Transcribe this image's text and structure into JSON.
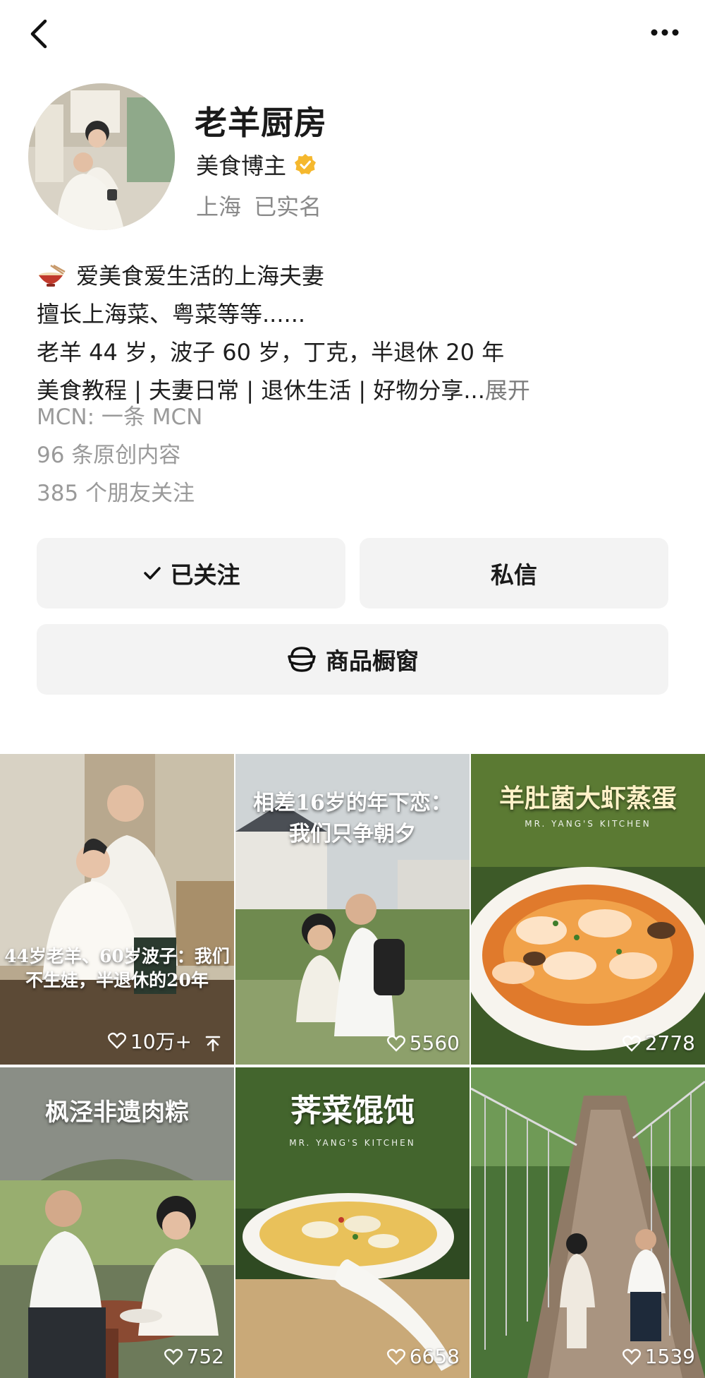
{
  "header": {
    "back_icon": "chevron-left-icon",
    "more_icon": "ellipsis-icon"
  },
  "profile": {
    "name": "老羊厨房",
    "role": "美食博主",
    "verified_icon": "verified-badge-icon",
    "verified_color": "#f5b82e",
    "location": "上海 已实名"
  },
  "bio": {
    "line1": "爱美食爱生活的上海夫妻",
    "line2": "擅长上海菜、粤菜等等......",
    "line3": "老羊 44 岁，波子 60 岁，丁克，半退休 20 年",
    "line4": "美食教程 | 夫妻日常 | 退休生活 | 好物分享...",
    "expand": "展开"
  },
  "meta": {
    "mcn": "MCN: 一条 MCN",
    "originals": "96 条原创内容",
    "friends": "385 个朋友关注"
  },
  "actions": {
    "follow_label": "已关注",
    "message_label": "私信",
    "shop_label": "商品橱窗"
  },
  "videos": [
    {
      "title": "44岁老羊、60岁波子：我们不生娃，半退休的20年",
      "likes": "10万+",
      "pinned": true
    },
    {
      "title": "相差16岁的年下恋：我们只争朝夕",
      "likes": "5560"
    },
    {
      "title": "羊肚菌大虾蒸蛋",
      "subtitle": "MR. YANG'S KITCHEN",
      "likes": "2778"
    },
    {
      "title": "枫泾非遗肉粽",
      "likes": "752"
    },
    {
      "title": "荠菜馄饨",
      "subtitle": "MR. YANG'S KITCHEN",
      "likes": "6658"
    },
    {
      "title": "",
      "likes": "1539"
    }
  ]
}
